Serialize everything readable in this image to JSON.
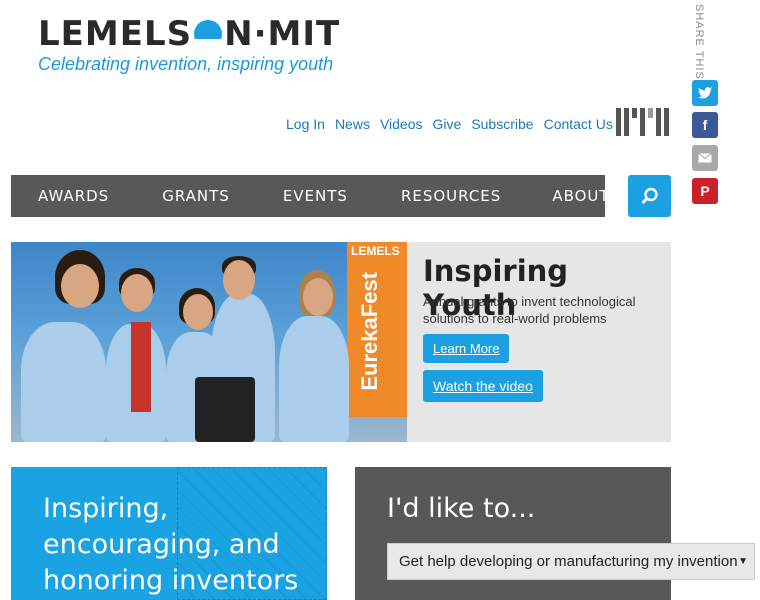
{
  "logo": {
    "text_left": "LEMELS",
    "text_right": "N·MIT",
    "tagline": "Celebrating invention, inspiring youth"
  },
  "top_links": [
    "Log In",
    "News",
    "Videos",
    "Give",
    "Subscribe",
    "Contact Us"
  ],
  "share": {
    "label": "SHARE THIS",
    "icons": [
      "twitter-icon",
      "facebook-icon",
      "email-icon",
      "pinterest-icon"
    ]
  },
  "nav": [
    "AWARDS",
    "GRANTS",
    "EVENTS",
    "RESOURCES",
    "ABOUT"
  ],
  "hero": {
    "poster_text": "EurekaFest",
    "poster_label": "LEMELS",
    "title": "Inspiring Youth",
    "subtitle": "Annual grants to invent technological solutions to real-world problems",
    "learn_more": "Learn More",
    "watch_video": "Watch the video"
  },
  "promo": {
    "line1": "Inspiring,",
    "line2": "encouraging, and",
    "line3": "honoring inventors"
  },
  "action": {
    "title": "I'd like to...",
    "selected": "Get help developing or manufacturing my invention"
  },
  "colors": {
    "accent": "#1ba0e2",
    "nav_bg": "#585858",
    "link": "#1a7ab8"
  }
}
